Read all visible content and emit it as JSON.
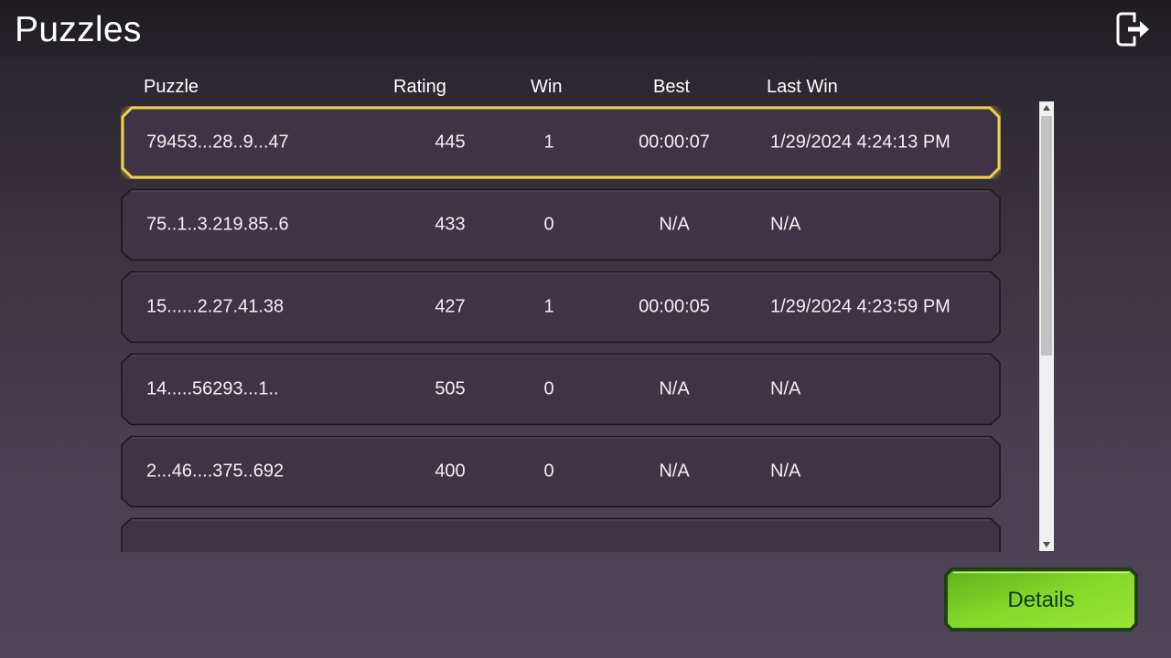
{
  "header": {
    "title": "Puzzles",
    "exit_icon": "exit-icon"
  },
  "columns": {
    "puzzle": "Puzzle",
    "rating": "Rating",
    "win": "Win",
    "best": "Best",
    "last_win": "Last Win"
  },
  "rows": [
    {
      "puzzle": "79453...28..9...47",
      "rating": "445",
      "win": "1",
      "best": "00:00:07",
      "last_win": "1/29/2024 4:24:13 PM",
      "selected": true
    },
    {
      "puzzle": "75..1..3.219.85..6",
      "rating": "433",
      "win": "0",
      "best": "N/A",
      "last_win": "N/A",
      "selected": false
    },
    {
      "puzzle": "15......2.27.41.38",
      "rating": "427",
      "win": "1",
      "best": "00:00:05",
      "last_win": "1/29/2024 4:23:59 PM",
      "selected": false
    },
    {
      "puzzle": "14.....56293...1..",
      "rating": "505",
      "win": "0",
      "best": "N/A",
      "last_win": "N/A",
      "selected": false
    },
    {
      "puzzle": "2...46....375..692",
      "rating": "400",
      "win": "0",
      "best": "N/A",
      "last_win": "N/A",
      "selected": false
    },
    {
      "puzzle": "",
      "rating": "",
      "win": "",
      "best": "",
      "last_win": "",
      "selected": false
    }
  ],
  "details_button": {
    "label": "Details"
  },
  "colors": {
    "row_fill": "#3e3445",
    "row_border": "#1c181f",
    "selected_border": "#f2d14a",
    "button_green": "#7ed321",
    "text_dark_green": "#123a14"
  }
}
